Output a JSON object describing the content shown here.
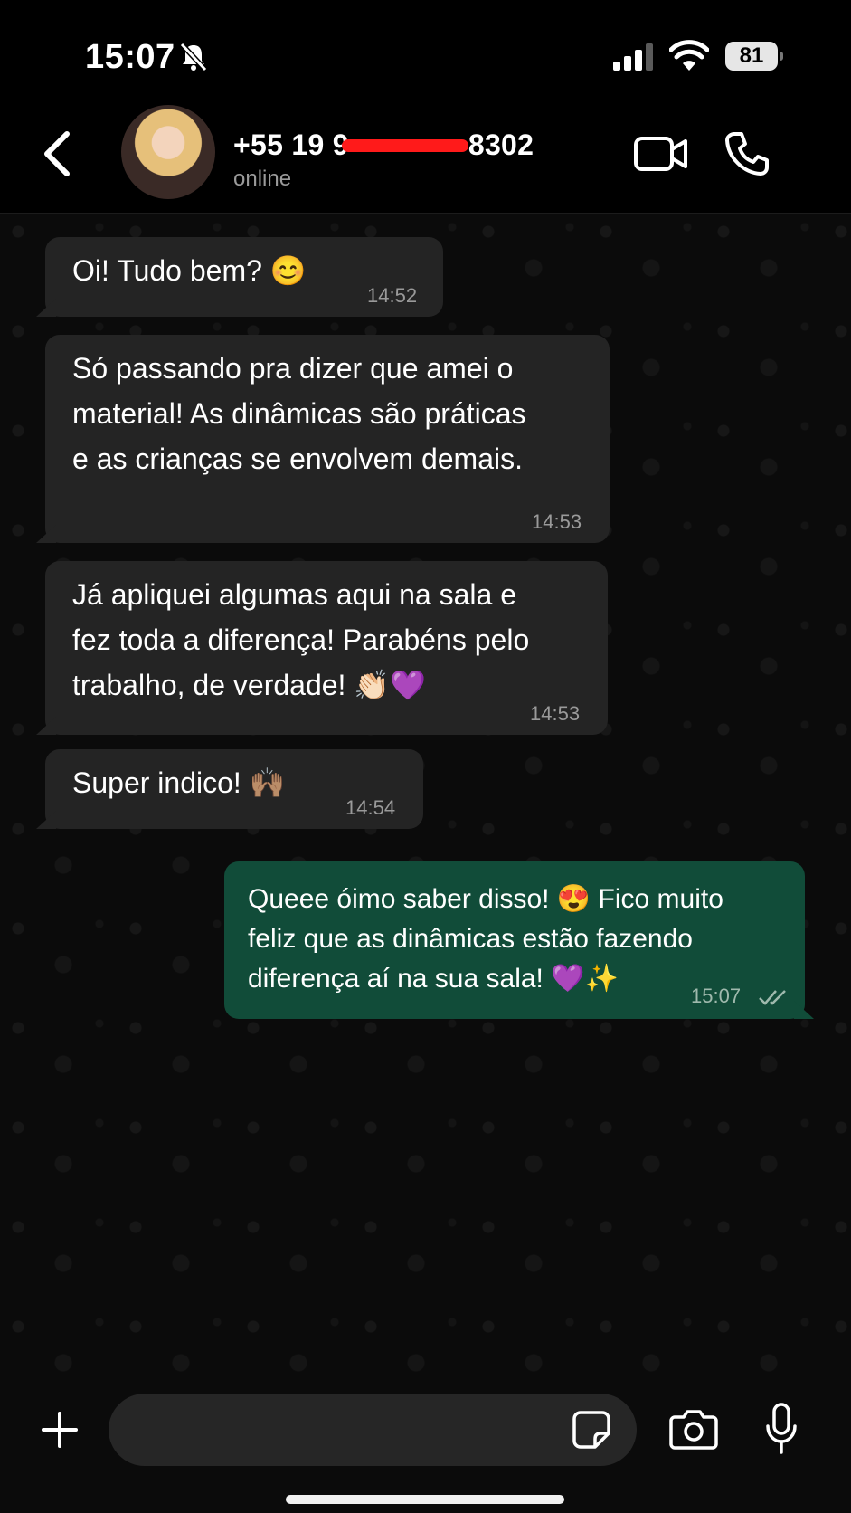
{
  "status_bar": {
    "time": "15:07",
    "battery": "81"
  },
  "header": {
    "name_prefix": "+55 19 9",
    "name_suffix": "8302",
    "status": "online"
  },
  "messages": [
    {
      "direction": "in",
      "lines": [
        "Oi! Tudo bem? 😊"
      ],
      "time": "14:52"
    },
    {
      "direction": "in",
      "lines": [
        "Só passando pra dizer que amei o",
        "material! As dinâmicas são práticas",
        "e as crianças se envolvem demais."
      ],
      "time": "14:53"
    },
    {
      "direction": "in",
      "lines": [
        "Já apliquei algumas aqui na sala e",
        "fez toda a diferença! Parabéns pelo",
        "trabalho, de verdade! 👏🏻💜"
      ],
      "time": "14:53"
    },
    {
      "direction": "in",
      "lines": [
        "Super indico! 🙌🏽"
      ],
      "time": "14:54"
    },
    {
      "direction": "out",
      "lines": [
        "Queee óimo saber disso! 😍 Fico muito",
        "feliz que as dinâmicas estão fazendo",
        "diferença aí na sua sala! 💜✨"
      ],
      "time": "15:07"
    }
  ],
  "input": {
    "placeholder": ""
  },
  "colors": {
    "incoming_bubble": "#242424",
    "outgoing_bubble": "#114c39",
    "background": "#0b0b0b",
    "redaction": "#ff1a1a"
  },
  "icons": [
    "bell-slash-icon",
    "signal-icon",
    "wifi-icon",
    "back-chevron-icon",
    "video-call-icon",
    "phone-icon",
    "plus-icon",
    "sticker-icon",
    "camera-icon",
    "microphone-icon",
    "double-check-icon"
  ]
}
